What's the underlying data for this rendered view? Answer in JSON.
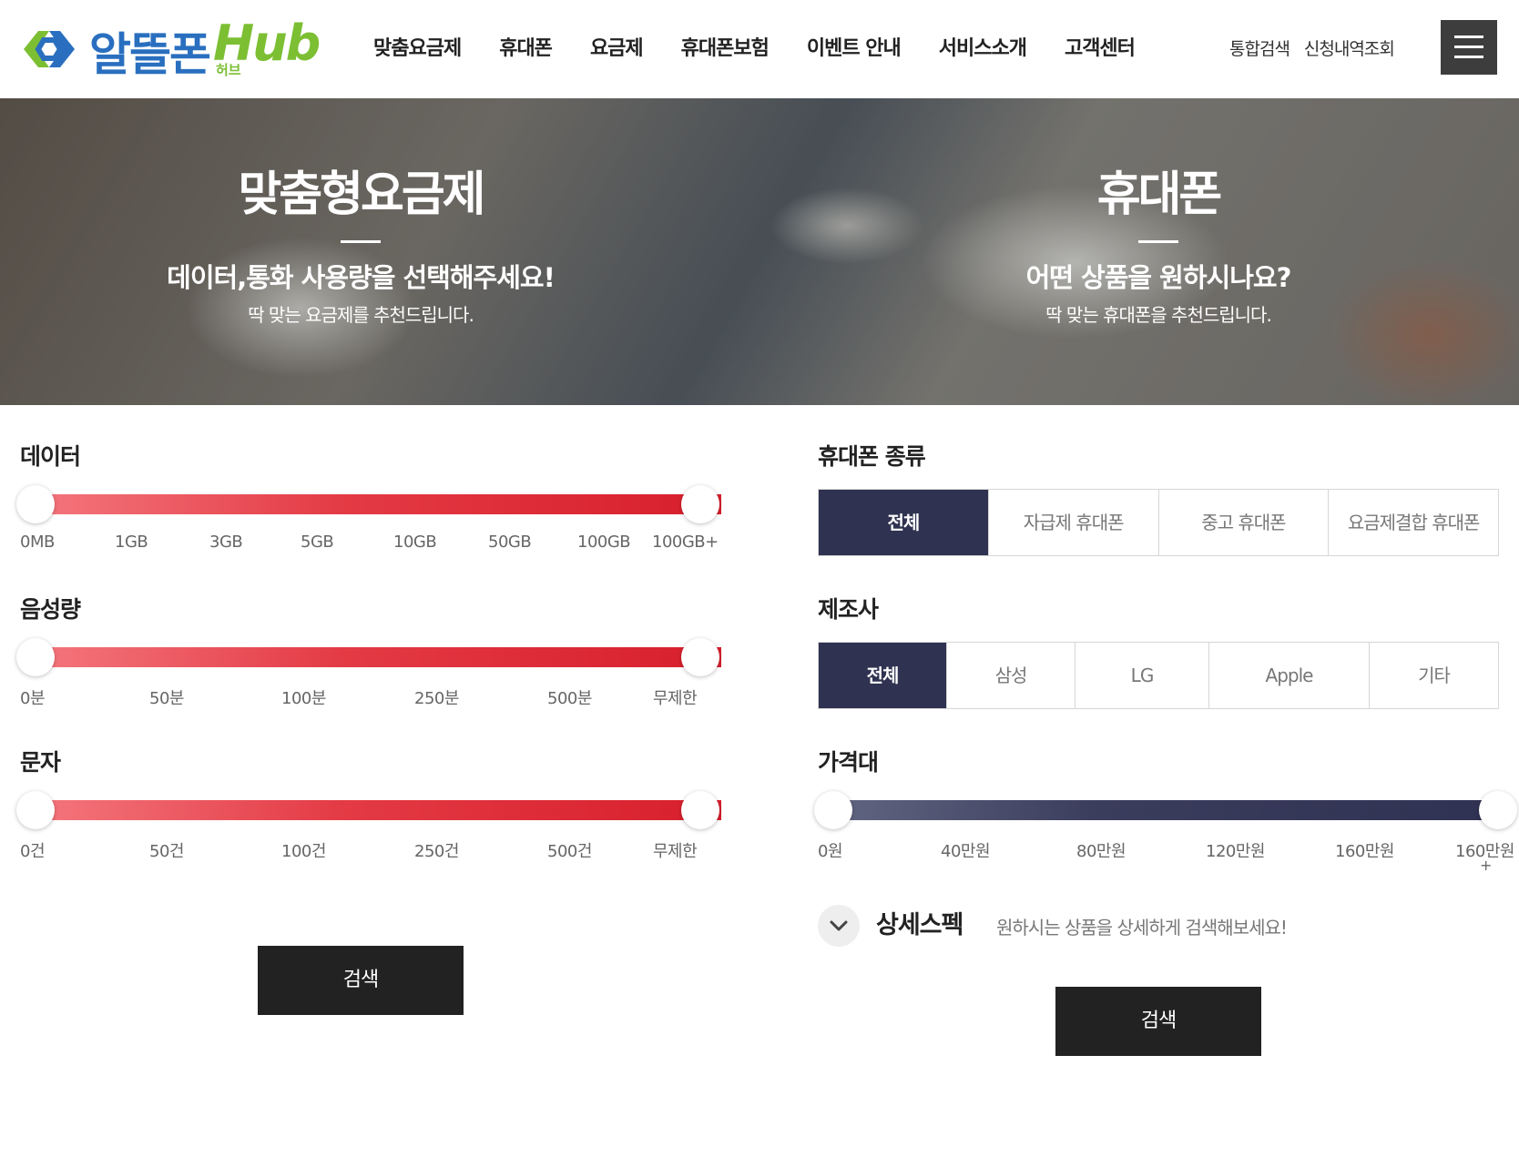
{
  "header": {
    "logo_text": "알뜰폰",
    "logo_hub": "Hub",
    "logo_sub": "허브",
    "nav": [
      "맞춤요금제",
      "휴대폰",
      "요금제",
      "휴대폰보험",
      "이벤트 안내",
      "서비스소개",
      "고객센터"
    ],
    "util": [
      "통합검색",
      "신청내역조회"
    ]
  },
  "hero": {
    "left": {
      "title": "맞춤형요금제",
      "subtitle": "데이터,통화 사용량을 선택해주세요!",
      "desc": "딱 맞는 요금제를 추천드립니다."
    },
    "right": {
      "title": "휴대폰",
      "subtitle": "어떤 상품을 원하시나요?",
      "desc": "딱 맞는 휴대폰을 추천드립니다."
    }
  },
  "plan": {
    "data": {
      "label": "데이터",
      "ticks": [
        "0MB",
        "1GB",
        "3GB",
        "5GB",
        "10GB",
        "50GB",
        "100GB",
        "100GB+"
      ],
      "range": [
        0,
        1
      ]
    },
    "voice": {
      "label": "음성량",
      "ticks": [
        "0분",
        "50분",
        "100분",
        "250분",
        "500분",
        "무제한"
      ],
      "range": [
        0,
        1
      ]
    },
    "sms": {
      "label": "문자",
      "ticks": [
        "0건",
        "50건",
        "100건",
        "250건",
        "500건",
        "무제한"
      ],
      "range": [
        0,
        1
      ]
    },
    "search_label": "검색"
  },
  "phone": {
    "type": {
      "label": "휴대폰 종류",
      "options": [
        "전체",
        "자급제 휴대폰",
        "중고 휴대폰",
        "요금제결합 휴대폰"
      ],
      "selected": "전체"
    },
    "maker": {
      "label": "제조사",
      "options": [
        "전체",
        "삼성",
        "LG",
        "Apple",
        "기타"
      ],
      "selected": "전체"
    },
    "price": {
      "label": "가격대",
      "ticks": [
        "0원",
        "40만원",
        "80만원",
        "120만원",
        "160만원",
        "160만원"
      ],
      "last_tick_suffix": "+",
      "range": [
        0,
        1
      ]
    },
    "spec": {
      "title": "상세스펙",
      "desc": "원하시는 상품을 상세하게 검색해보세요!"
    },
    "search_label": "검색"
  },
  "colors": {
    "accent_red": "#e33a45",
    "navy": "#2f3250",
    "dark_button": "#222222"
  }
}
